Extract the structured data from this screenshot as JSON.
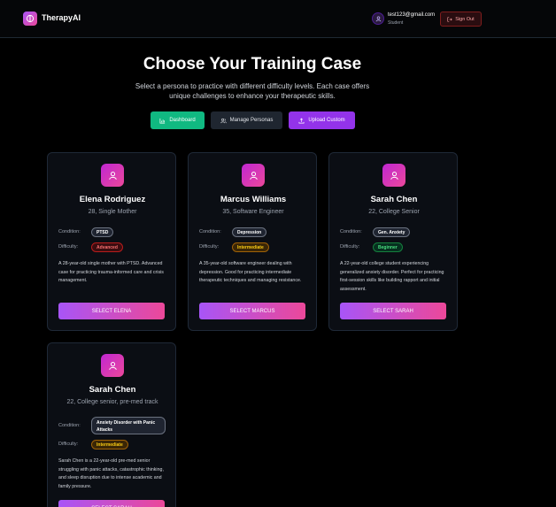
{
  "app": {
    "title": "TherapyAI"
  },
  "user": {
    "email": "test123@gmail.com",
    "role": "Student"
  },
  "header": {
    "signout_label": "Sign Out"
  },
  "hero": {
    "title": "Choose Your Training Case",
    "subtitle": "Select a persona to practice with different difficulty levels. Each case offers unique challenges to enhance your therapeutic skills."
  },
  "actions": {
    "dashboard": "Dashboard",
    "manage": "Manage Personas",
    "upload": "Upload Custom"
  },
  "labels": {
    "condition": "Condition:",
    "difficulty": "Difficulty:"
  },
  "cards": [
    {
      "name": "Elena Rodriguez",
      "meta": "28, Single Mother",
      "condition": "PTSD",
      "difficulty": "Advanced",
      "description": "A 28-year-old single mother with PTSD. Advanced case for practicing trauma-informed care and crisis management.",
      "button": "SELECT ELENA"
    },
    {
      "name": "Marcus Williams",
      "meta": "35, Software Engineer",
      "condition": "Depression",
      "difficulty": "Intermediate",
      "description": "A 35-year-old software engineer dealing with depression. Good for practicing intermediate therapeutic techniques and managing resistance.",
      "button": "SELECT MARCUS"
    },
    {
      "name": "Sarah Chen",
      "meta": "22, College Senior",
      "condition": "Gen. Anxiety",
      "difficulty": "Beginner",
      "description": "A 22-year-old college student experiencing generalized anxiety disorder. Perfect for practicing first-session skills like building rapport and initial assessment.",
      "button": "SELECT SARAH"
    },
    {
      "name": "Sarah Chen",
      "meta": "22, College senior, pre-med track",
      "condition": "Anxiety Disorder with Panic Attacks",
      "difficulty": "Intermediate",
      "description": "Sarah Chen is a 22-year-old pre-med senior struggling with panic attacks, catastrophic thinking, and sleep disruption due to intense academic and family pressure.",
      "button": "SELECT SARAH"
    }
  ]
}
